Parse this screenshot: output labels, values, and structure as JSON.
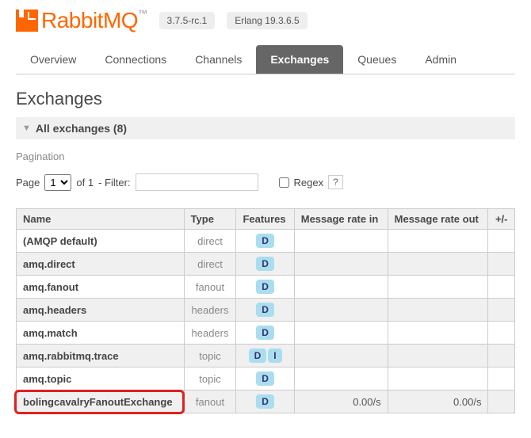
{
  "logo": {
    "text1": "Rabbit",
    "text2": "MQ",
    "tm": "™"
  },
  "versions": {
    "rabbitmq": "3.7.5-rc.1",
    "erlang": "Erlang 19.3.6.5"
  },
  "tabs": [
    "Overview",
    "Connections",
    "Channels",
    "Exchanges",
    "Queues",
    "Admin"
  ],
  "active_tab": "Exchanges",
  "page_title": "Exchanges",
  "section": {
    "label": "All exchanges (8)"
  },
  "pagination": {
    "label": "Pagination",
    "page_label": "Page",
    "page_value": "1",
    "of_label": "of 1",
    "filter_label": "- Filter:",
    "filter_value": "",
    "regex_label": "Regex",
    "q": "?"
  },
  "columns": {
    "name": "Name",
    "type": "Type",
    "features": "Features",
    "rate_in": "Message rate in",
    "rate_out": "Message rate out",
    "pm": "+/-"
  },
  "rows": [
    {
      "name": "(AMQP default)",
      "type": "direct",
      "features": [
        "D"
      ],
      "rate_in": "",
      "rate_out": ""
    },
    {
      "name": "amq.direct",
      "type": "direct",
      "features": [
        "D"
      ],
      "rate_in": "",
      "rate_out": ""
    },
    {
      "name": "amq.fanout",
      "type": "fanout",
      "features": [
        "D"
      ],
      "rate_in": "",
      "rate_out": ""
    },
    {
      "name": "amq.headers",
      "type": "headers",
      "features": [
        "D"
      ],
      "rate_in": "",
      "rate_out": ""
    },
    {
      "name": "amq.match",
      "type": "headers",
      "features": [
        "D"
      ],
      "rate_in": "",
      "rate_out": ""
    },
    {
      "name": "amq.rabbitmq.trace",
      "type": "topic",
      "features": [
        "D",
        "I"
      ],
      "rate_in": "",
      "rate_out": ""
    },
    {
      "name": "amq.topic",
      "type": "topic",
      "features": [
        "D"
      ],
      "rate_in": "",
      "rate_out": ""
    },
    {
      "name": "bolingcavalryFanoutExchange",
      "type": "fanout",
      "features": [
        "D"
      ],
      "rate_in": "0.00/s",
      "rate_out": "0.00/s",
      "highlight": true
    }
  ]
}
